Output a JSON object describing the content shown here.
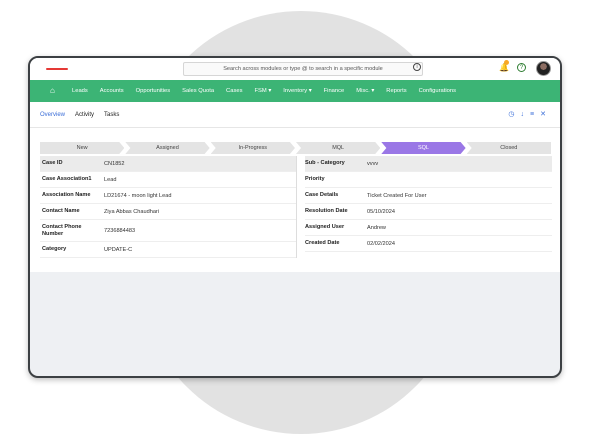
{
  "search": {
    "placeholder": "Search across modules or type @ to search in a specific module"
  },
  "nav": [
    "Leads",
    "Accounts",
    "Opportunities",
    "Sales Quota",
    "Cases",
    "FSM ▾",
    "Inventory ▾",
    "Finance",
    "Misc. ▾",
    "Reports",
    "Configurations"
  ],
  "tabs": [
    "Overview",
    "Activity",
    "Tasks"
  ],
  "stages": [
    "New",
    "Assigned",
    "In-Progress",
    "MQL",
    "SQL",
    "Closed"
  ],
  "current_stage": "SQL",
  "fields_left": [
    {
      "label": "Case ID",
      "value": "CN1852"
    },
    {
      "label": "Case Association1",
      "value": "Lead"
    },
    {
      "label": "Association Name",
      "value": "LD21674 - moon light Lead"
    },
    {
      "label": "Contact Name",
      "value": "Ziya Abbas Chaudhari"
    },
    {
      "label": "Contact Phone Number",
      "value": "7236884483"
    },
    {
      "label": "Category",
      "value": "UPDATE-C"
    }
  ],
  "fields_right": [
    {
      "label": "Sub - Category",
      "value": "vvvv"
    },
    {
      "label": "Priority",
      "value": ""
    },
    {
      "label": "Case Details",
      "value": "Ticket Created For User"
    },
    {
      "label": "Resolution Date",
      "value": "05/10/2024"
    },
    {
      "label": "Assigned User",
      "value": "Andrew"
    },
    {
      "label": "Created Date",
      "value": "02/02/2024"
    }
  ],
  "colors": {
    "nav": "#3cb475",
    "accent": "#3b6ed8",
    "stage_active": "#9a77e6"
  }
}
